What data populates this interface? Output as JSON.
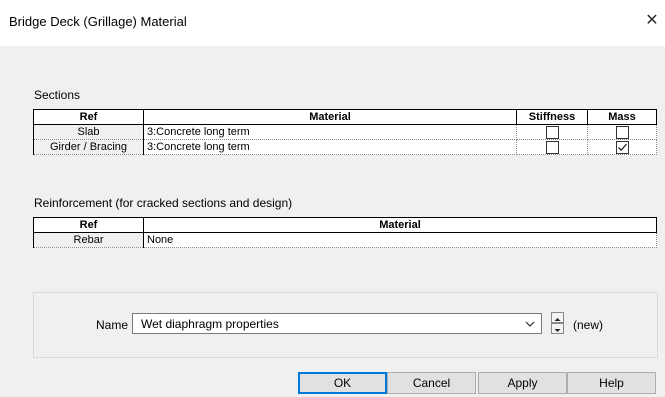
{
  "window": {
    "title": "Bridge Deck (Grillage) Material",
    "close_glyph": "✕"
  },
  "sections": {
    "label": "Sections",
    "columns": {
      "ref": "Ref",
      "material": "Material",
      "stiffness": "Stiffness",
      "mass": "Mass"
    },
    "rows": [
      {
        "ref": "Slab",
        "material": "3:Concrete long term",
        "stiffness": false,
        "mass": false
      },
      {
        "ref": "Girder / Bracing",
        "material": "3:Concrete long term",
        "stiffness": false,
        "mass": true
      }
    ]
  },
  "reinforcement": {
    "label": "Reinforcement (for cracked sections and design)",
    "columns": {
      "ref": "Ref",
      "material": "Material"
    },
    "rows": [
      {
        "ref": "Rebar",
        "material": "None"
      }
    ]
  },
  "name_field": {
    "label": "Name",
    "value": "Wet diaphragm properties",
    "status": "(new)"
  },
  "buttons": {
    "ok": "OK",
    "cancel": "Cancel",
    "apply": "Apply",
    "help": "Help"
  },
  "icons": {
    "close": "close-icon",
    "dropdown": "chevron-down-icon",
    "spin_up": "spin-up-icon",
    "spin_down": "spin-down-icon",
    "check": "checkmark-icon"
  }
}
